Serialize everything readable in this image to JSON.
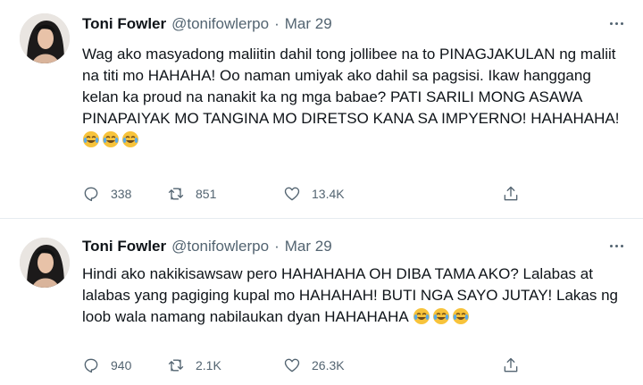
{
  "tweets": [
    {
      "name": "Toni Fowler",
      "handle": "@tonifowlerpo",
      "separator": "·",
      "date": "Mar 29",
      "text": "Wag ako masyadong maliitin dahil tong jollibee na to PINAGJAKULAN ng maliit na titi mo HAHAHA! Oo naman umiyak ako dahil sa pagsisi. Ikaw hanggang kelan ka proud na nanakit ka ng mga babae? PATI SARILI MONG ASAWA PINAPAIYAK MO TANGINA MO DIRETSO KANA SA IMPYERNO! HAHAHAHA! ",
      "emoji": [
        "face-with-tears-of-joy-icon",
        "face-with-tears-of-joy-icon",
        "face-with-tears-of-joy-icon"
      ],
      "replies": "338",
      "retweets": "851",
      "likes": "13.4K"
    },
    {
      "name": "Toni Fowler",
      "handle": "@tonifowlerpo",
      "separator": "·",
      "date": "Mar 29",
      "text": "Hindi ako nakikisawsaw pero HAHAHAHA OH DIBA TAMA AKO? Lalabas at lalabas yang pagiging kupal mo HAHAHAH! BUTI NGA SAYO JUTAY! Lakas ng loob wala namang nabilaukan dyan HAHAHAHA ",
      "emoji": [
        "face-with-tears-of-joy-icon",
        "face-with-tears-of-joy-icon",
        "face-with-tears-of-joy-icon"
      ],
      "replies": "940",
      "retweets": "2.1K",
      "likes": "26.3K"
    }
  ],
  "colors": {
    "text": "#0f1419",
    "muted": "#536471",
    "divider": "#e6ecf0",
    "emoji_face": "#f7c33b"
  }
}
